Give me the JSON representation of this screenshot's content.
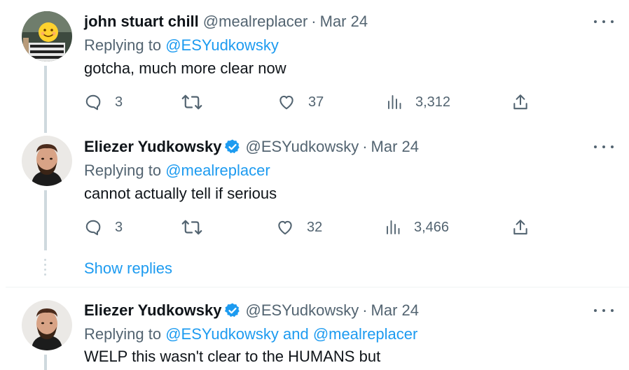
{
  "tweets": [
    {
      "author_name": "john stuart chill",
      "handle": "@mealreplacer",
      "separator": "·",
      "date": "Mar 24",
      "verified": false,
      "replying_prefix": "Replying to ",
      "replying_to": "@ESYudkowsky",
      "text": "gotcha, much more clear now",
      "replies": "3",
      "retweets": "",
      "likes": "37",
      "views": "3,312"
    },
    {
      "author_name": "Eliezer Yudkowsky",
      "handle": "@ESYudkowsky",
      "separator": "·",
      "date": "Mar 24",
      "verified": true,
      "replying_prefix": "Replying to ",
      "replying_to": "@mealreplacer",
      "text": "cannot actually tell if serious",
      "replies": "3",
      "retweets": "",
      "likes": "32",
      "views": "3,466"
    },
    {
      "author_name": "Eliezer Yudkowsky",
      "handle": "@ESYudkowsky",
      "separator": "·",
      "date": "Mar 24",
      "verified": true,
      "replying_prefix": "Replying to ",
      "replying_to": "@ESYudkowsky and @mealreplacer",
      "text": "WELP this wasn't clear to the HUMANS but"
    }
  ],
  "show_replies_label": "Show replies",
  "colors": {
    "link": "#1d9bf0",
    "secondary_text": "#536471",
    "primary_text": "#0f1419",
    "thread_line": "#cfd9de"
  },
  "icons": [
    "reply-icon",
    "retweet-icon",
    "like-icon",
    "views-icon",
    "share-icon",
    "more-icon",
    "verified-badge-icon"
  ]
}
